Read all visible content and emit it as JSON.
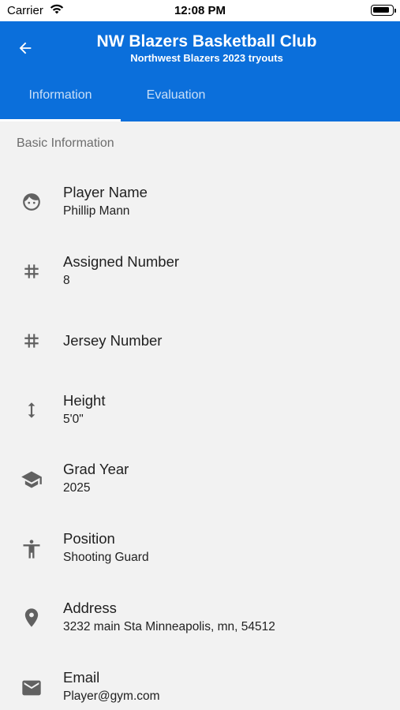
{
  "status_bar": {
    "carrier": "Carrier",
    "time": "12:08 PM",
    "battery_level": 0.9
  },
  "app_bar": {
    "title": "NW Blazers Basketball Club",
    "subtitle": "Northwest Blazers 2023 tryouts",
    "back_icon": "arrow-left-icon",
    "background_color": "#0b6fdb"
  },
  "tabs": [
    {
      "label": "Information",
      "selected": true
    },
    {
      "label": "Evaluation",
      "selected": false
    }
  ],
  "section": {
    "title": "Basic Information"
  },
  "fields": [
    {
      "icon": "face-icon",
      "label": "Player Name",
      "value": "Phillip Mann"
    },
    {
      "icon": "hash-icon",
      "label": "Assigned Number",
      "value": "8"
    },
    {
      "icon": "hash-icon",
      "label": "Jersey Number",
      "value": ""
    },
    {
      "icon": "vertical-arrows-icon",
      "label": "Height",
      "value": "5'0\""
    },
    {
      "icon": "graduation-cap-icon",
      "label": "Grad Year",
      "value": "2025"
    },
    {
      "icon": "accessibility-person-icon",
      "label": "Position",
      "value": "Shooting Guard"
    },
    {
      "icon": "location-pin-icon",
      "label": "Address",
      "value": "3232 main Sta Minneapolis, mn, 54512"
    },
    {
      "icon": "mail-icon",
      "label": "Email",
      "value": "Player@gym.com"
    }
  ]
}
